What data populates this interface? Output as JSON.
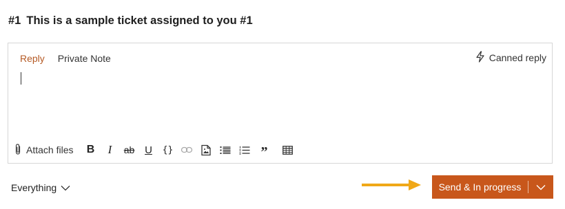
{
  "ticket": {
    "number": "#1",
    "title": "This is a sample ticket assigned to you #1"
  },
  "editor": {
    "tabs": [
      {
        "label": "Reply",
        "active": true
      },
      {
        "label": "Private Note",
        "active": false
      }
    ],
    "canned_reply_label": "Canned reply",
    "content": "",
    "toolbar": {
      "attach_label": "Attach files",
      "bold_glyph": "B",
      "italic_glyph": "I",
      "strike_glyph": "ab",
      "underline_glyph": "U",
      "code_glyph": "{}",
      "quote_glyph": "”"
    }
  },
  "footer": {
    "filter_label": "Everything",
    "send_label": "Send & In progress"
  },
  "colors": {
    "accent": "#c8571b",
    "active_tab": "#b55a25",
    "annotation_arrow": "#f0a818",
    "border": "#d6d6d6"
  },
  "icons": {
    "canned": "lightning-icon",
    "attach": "paperclip-icon",
    "link": "link-icon",
    "image": "image-icon",
    "bullet_list": "bullet-list-icon",
    "numbered_list": "numbered-list-icon",
    "table": "table-icon",
    "filter_chevron": "chevron-down-icon",
    "send_chevron": "chevron-down-icon"
  }
}
